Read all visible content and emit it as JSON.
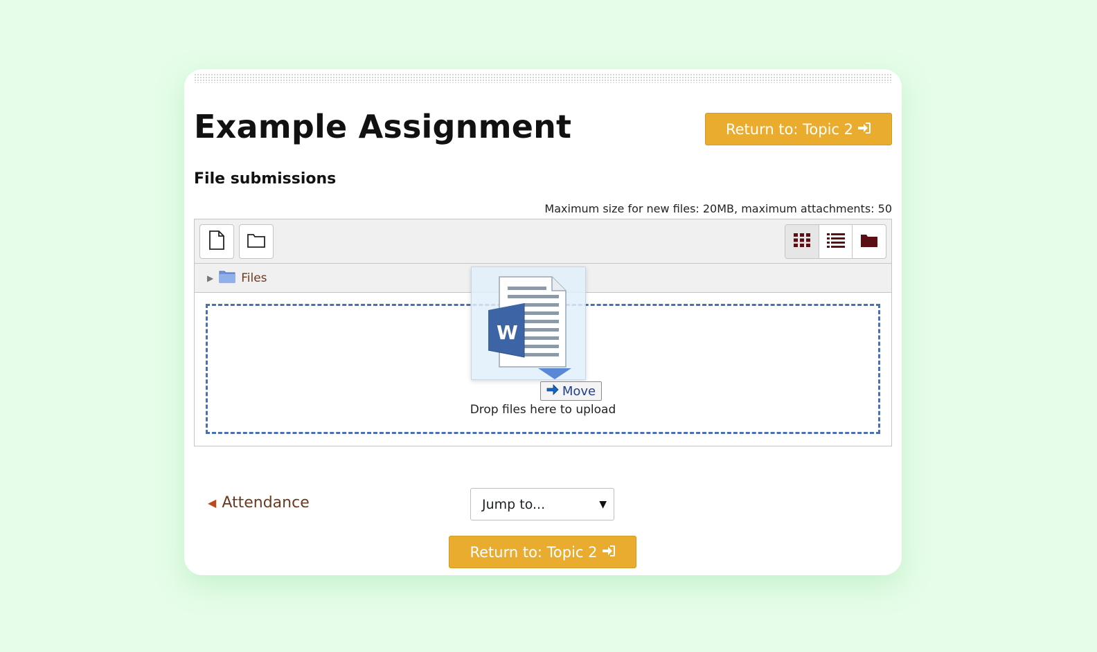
{
  "page": {
    "title": "Example Assignment",
    "return_button_label": "Return to: Topic 2"
  },
  "submissions": {
    "heading": "File submissions",
    "limits_text": "Maximum size for new files: 20MB, maximum attachments: 50"
  },
  "file_manager": {
    "toolbar_icons": [
      "add-file-icon",
      "create-folder-icon"
    ],
    "view_icons": [
      "grid-view-icon",
      "list-view-icon",
      "tree-view-icon"
    ],
    "path_label": "Files",
    "drop_text": "Drop files here to upload"
  },
  "drag_feedback": {
    "file_badge_letter": "W",
    "action_label": "Move"
  },
  "navigation": {
    "previous_activity": "Attendance",
    "jump_placeholder": "Jump to..."
  },
  "colors": {
    "accent": "#e9ac2e",
    "background": "#e5fde9",
    "link": "#6a3a20",
    "dropzone_border": "#4a6fb5",
    "view_icon": "#5b0f14"
  }
}
